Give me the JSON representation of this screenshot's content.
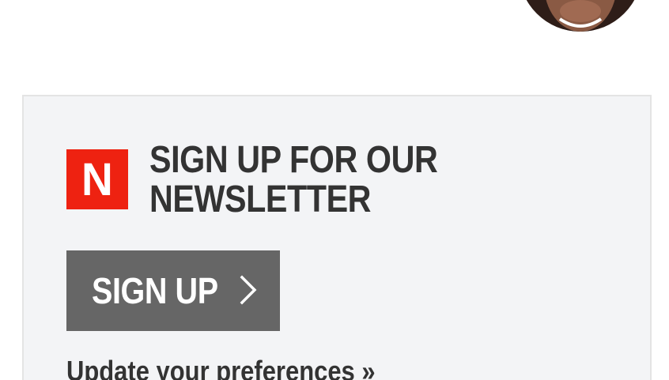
{
  "newsletter": {
    "logo_letter": "N",
    "heading_line1": "SIGN UP FOR OUR",
    "heading_line2": "NEWSLETTER",
    "signup_label": "SIGN UP",
    "preferences_link": "Update your preferences »"
  },
  "icons": {
    "logo": "n-logo-icon",
    "chevron": "chevron-right-icon",
    "avatar": "avatar-photo"
  },
  "colors": {
    "logo_background": "#ee2211",
    "button_background": "#666666",
    "panel_background": "#f3f4f6",
    "text": "#333333"
  }
}
